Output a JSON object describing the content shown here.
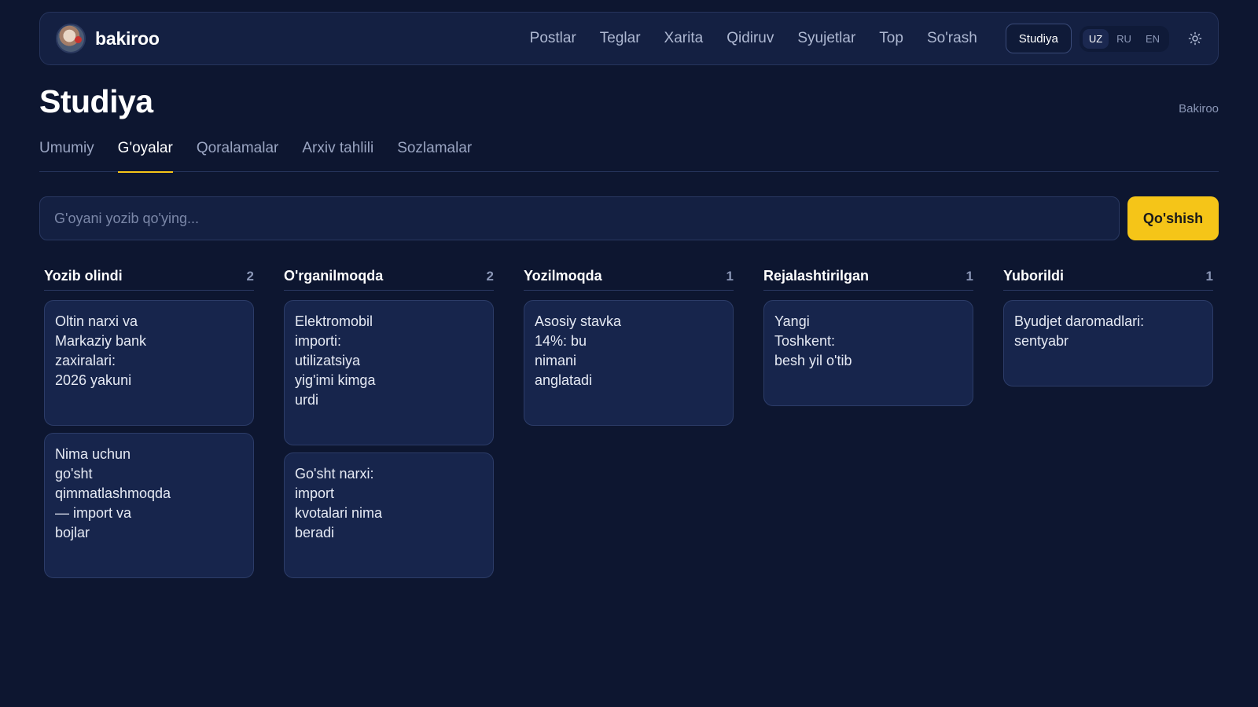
{
  "header": {
    "brand": "bakiroo",
    "nav": [
      "Postlar",
      "Teglar",
      "Xarita",
      "Qidiruv",
      "Syujetlar",
      "Top",
      "So'rash"
    ],
    "studio_button": "Studiya",
    "languages": [
      "UZ",
      "RU",
      "EN"
    ],
    "active_language": "UZ",
    "theme_icon": "sun-icon"
  },
  "page": {
    "title": "Studiya",
    "owner": "Bakiroo"
  },
  "tabs": [
    {
      "label": "Umumiy",
      "active": false
    },
    {
      "label": "G'oyalar",
      "active": true
    },
    {
      "label": "Qoralamalar",
      "active": false
    },
    {
      "label": "Arxiv tahlili",
      "active": false
    },
    {
      "label": "Sozlamalar",
      "active": false
    }
  ],
  "composer": {
    "placeholder": "G'oyani yozib qo'ying...",
    "value": "",
    "add_label": "Qo'shish"
  },
  "columns": [
    {
      "title": "Yozib olindi",
      "count": "2",
      "cards": [
        {
          "lines": [
            "Oltin narxi va",
            "Markaziy bank",
            "zaxiralari:",
            "2026 yakuni"
          ]
        },
        {
          "lines": [
            "Nima uchun",
            "go'sht",
            "qimmatlashmoqda",
            "— import va",
            "bojlar"
          ]
        }
      ]
    },
    {
      "title": "O'rganilmoqda",
      "count": "2",
      "cards": [
        {
          "lines": [
            "Elektromobil",
            "importi:",
            "utilizatsiya",
            "yig'imi kimga",
            "urdi"
          ]
        },
        {
          "lines": [
            "Go'sht narxi:",
            "import",
            "kvotalari nima",
            "beradi"
          ]
        }
      ]
    },
    {
      "title": "Yozilmoqda",
      "count": "1",
      "cards": [
        {
          "lines": [
            "Asosiy stavka",
            "14%: bu",
            "nimani",
            "anglatadi"
          ]
        }
      ]
    },
    {
      "title": "Rejalashtirilgan",
      "count": "1",
      "cards": [
        {
          "lines": [
            "Yangi",
            "Toshkent:",
            "besh yil o'tib"
          ]
        }
      ]
    },
    {
      "title": "Yuborildi",
      "count": "1",
      "cards": [
        {
          "lines": [
            "Byudjet daromadlari:",
            "sentyabr"
          ]
        }
      ]
    }
  ],
  "colors": {
    "background": "#0d1630",
    "surface": "#142042",
    "card": "#17254c",
    "accent": "#f5c518"
  }
}
